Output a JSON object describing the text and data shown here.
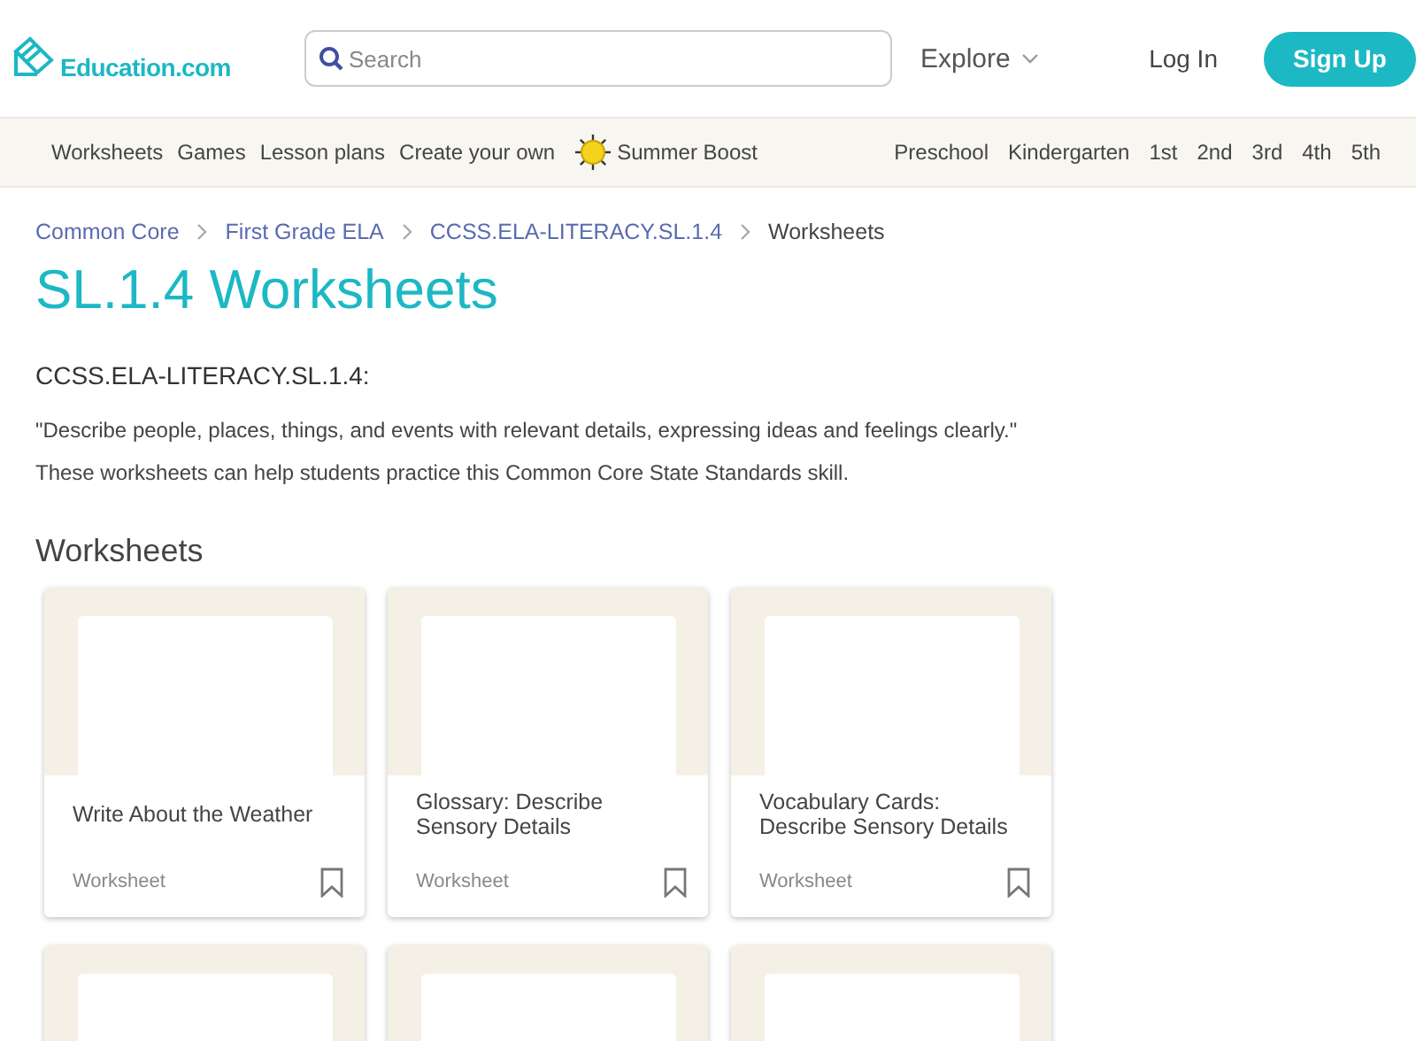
{
  "header": {
    "logo": "Education.com",
    "search": {
      "placeholder": "Search"
    },
    "explore": "Explore",
    "login": "Log In",
    "signup": "Sign Up"
  },
  "nav": {
    "left": [
      {
        "label": "Worksheets",
        "kind": "link"
      },
      {
        "label": "Games",
        "kind": "link"
      },
      {
        "label": "Lesson plans",
        "kind": "link"
      },
      {
        "label": "Create your own",
        "kind": "link"
      },
      {
        "label": "Summer Boost",
        "kind": "promo"
      }
    ],
    "grades": [
      "Preschool",
      "Kindergarten",
      "1st",
      "2nd",
      "3rd",
      "4th",
      "5th"
    ]
  },
  "breadcrumb": [
    {
      "label": "Common Core",
      "current": false
    },
    {
      "label": "First Grade ELA",
      "current": false
    },
    {
      "label": "CCSS.ELA-LITERACY.SL.1.4",
      "current": false
    },
    {
      "label": "Worksheets",
      "current": true
    }
  ],
  "title": "SL.1.4 Worksheets",
  "standard": "CCSS.ELA-LITERACY.SL.1.4:",
  "quote": "\"Describe people, places, things, and events with relevant details, expressing ideas and feelings clearly.\"",
  "description": "These worksheets can help students practice this Common Core State Standards skill.",
  "section_title": "Worksheets",
  "cards": [
    {
      "kind": "full",
      "title": "Write About the Weather",
      "type": "Worksheet"
    },
    {
      "kind": "full",
      "title": "Glossary: Describe Sensory Details",
      "type": "Worksheet"
    },
    {
      "kind": "full",
      "title": "Vocabulary Cards: Describe Sensory Details",
      "type": "Worksheet"
    },
    {
      "kind": "cut"
    },
    {
      "kind": "cut"
    },
    {
      "kind": "cut"
    }
  ]
}
